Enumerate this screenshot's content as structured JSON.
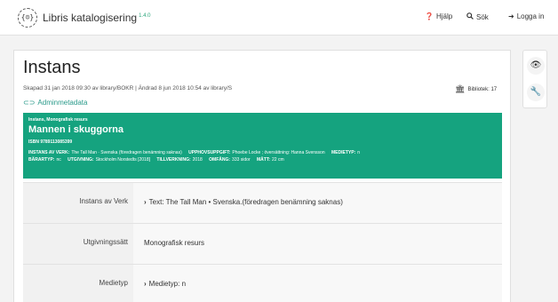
{
  "header": {
    "logo_text": "{☺}",
    "app_title": "Libris katalogisering",
    "version": "1.4.0",
    "nav": {
      "help": "Hjälp",
      "search": "Sök",
      "login": "Logga in"
    }
  },
  "record": {
    "page_title": "Instans",
    "created_line": "Skapad 31 jan 2018 09:30 av library/BOKR | Ändrad 8 jun 2018 10:54 av library/S",
    "library_label": "Bibliotek: 17",
    "admin_link": "Adminmetadata"
  },
  "summary": {
    "type": "Instans, Monografisk resurs",
    "title": "Mannen i skuggorna",
    "isbn": "ISBN 9789113085399",
    "fields": [
      {
        "key": "INSTANS AV VERK:",
        "value": "The Tall Man · Svenska (föredragen benämning saknas)"
      },
      {
        "key": "UPPHOVSUPPGIFT:",
        "value": "Phoebe Locke ; översättning: Hanna Svensson"
      },
      {
        "key": "MEDIETYP:",
        "value": "n"
      },
      {
        "key": "BÄRARTYP:",
        "value": "nc"
      },
      {
        "key": "UTGIVNING:",
        "value": "Stockholm Norstedts [2018]"
      },
      {
        "key": "TILLVERKNING:",
        "value": "2018"
      },
      {
        "key": "OMFÅNG:",
        "value": "333 sidor"
      },
      {
        "key": "MÅTT:",
        "value": "22 cm"
      }
    ]
  },
  "properties": [
    {
      "label": "Instans av Verk",
      "value": "Text: The Tall Man • Svenska.(föredragen benämning saknas)"
    },
    {
      "label": "Utgivningssätt",
      "value": "Monografisk resurs"
    },
    {
      "label": "Medietyp",
      "value": "Medietyp: n"
    }
  ],
  "tools": {
    "preview_icon": "eye-icon",
    "tools_icon": "wrench-icon"
  },
  "colors": {
    "accent": "#15a37f",
    "link": "#2a9a8a",
    "version": "#2aa57a"
  }
}
